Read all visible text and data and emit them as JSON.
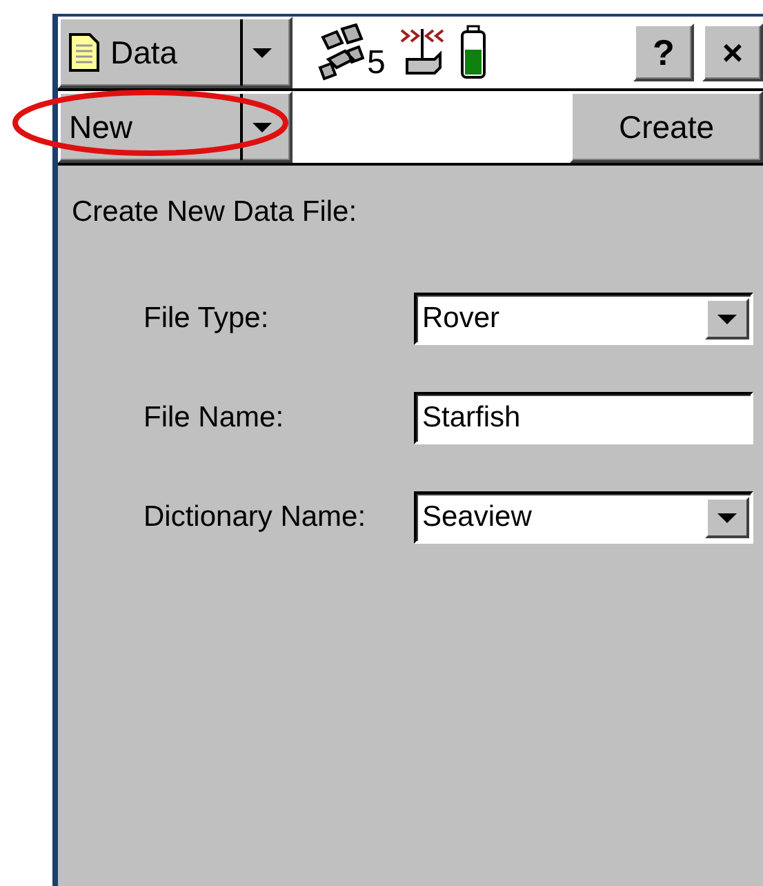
{
  "app_menu": {
    "label": "Data"
  },
  "status": {
    "satellite_count": "5"
  },
  "title_buttons": [
    "?",
    "×"
  ],
  "toolbar": {
    "mode": {
      "value": "New",
      "highlighted": true
    },
    "action_button": "Create"
  },
  "form": {
    "heading": "Create New Data File:",
    "fields": [
      {
        "kind": "dropdown",
        "label": "File Type:",
        "value": "Rover"
      },
      {
        "kind": "text",
        "label": "File Name:",
        "value": "Starfish"
      },
      {
        "kind": "dropdown",
        "label": "Dictionary Name:",
        "value": "Seaview"
      }
    ]
  }
}
